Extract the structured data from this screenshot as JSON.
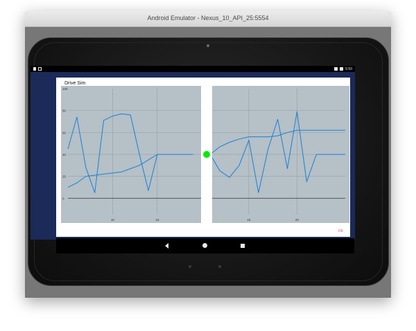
{
  "window": {
    "title": "Android Emulator - Nexus_10_API_25:5554"
  },
  "status_bar": {
    "time": "5:50"
  },
  "dialog": {
    "title": "Drive Sim",
    "ok_label": "OK"
  },
  "chart_data": [
    {
      "type": "line",
      "ylim": [
        -15,
        100
      ],
      "y_ticks": [
        0,
        20,
        40,
        60,
        80,
        100
      ],
      "x_ticks": [
        10,
        15
      ],
      "series": [
        {
          "x": [
            5,
            6,
            7,
            8,
            9,
            10,
            11,
            12,
            13,
            14,
            15,
            16,
            17,
            18,
            19
          ],
          "values": [
            45,
            74,
            28,
            5,
            71,
            75,
            77,
            76,
            40,
            7,
            40,
            40,
            40,
            40,
            40
          ]
        },
        {
          "x": [
            5,
            6,
            7,
            8,
            9,
            10,
            11,
            12,
            13,
            14,
            15,
            16,
            17,
            18,
            19
          ],
          "values": [
            10,
            14,
            20,
            21,
            22,
            23,
            24,
            27,
            30,
            35,
            40,
            40,
            40,
            40,
            40
          ]
        }
      ],
      "marker": {
        "x": 19.5,
        "y": 40,
        "color": "#00ee00"
      }
    },
    {
      "type": "line",
      "ylim": [
        -15,
        100
      ],
      "x_ticks": [
        15,
        20
      ],
      "series": [
        {
          "x": [
            11,
            12,
            13,
            14,
            15,
            16,
            17,
            18,
            19,
            20,
            21,
            22,
            23,
            24,
            25
          ],
          "values": [
            40,
            25,
            19,
            30,
            53,
            5,
            45,
            72,
            27,
            79,
            15,
            40,
            40,
            40,
            40
          ]
        },
        {
          "x": [
            11,
            12,
            13,
            14,
            15,
            16,
            17,
            18,
            19,
            20,
            21,
            22,
            23,
            24,
            25
          ],
          "values": [
            40,
            47,
            51,
            54,
            56,
            56,
            56,
            57,
            60,
            62,
            62,
            62,
            62,
            62,
            62
          ]
        }
      ]
    }
  ],
  "colors": {
    "line": "#1a7fd4",
    "chart_bg": "#b5c0c7",
    "grid": "#8f9aa1",
    "axis": "#333333",
    "accent": "#ff4081",
    "marker": "#00ee00"
  }
}
